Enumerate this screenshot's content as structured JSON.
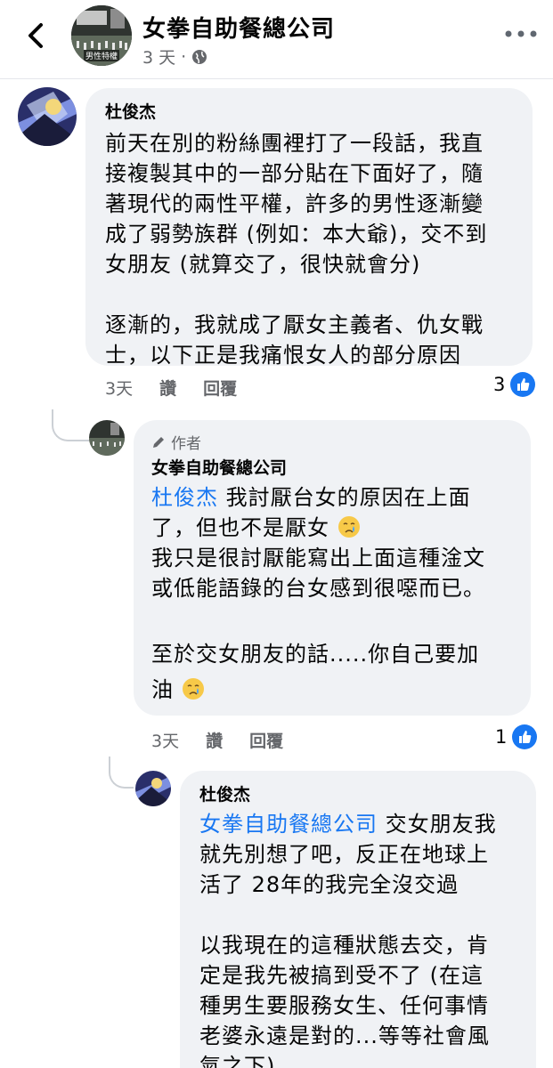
{
  "header": {
    "page_name": "女拳自助餐總公司",
    "time": "3 天",
    "dot": "·",
    "avatar_caption": "男性特權"
  },
  "comments": [
    {
      "author": "杜俊杰",
      "paragraphs": [
        "前天在別的粉絲團裡打了一段話，我直",
        "接複製其中的一部分貼在下面好了，隨",
        "著現代的兩性平權，許多的男性逐漸變",
        "成了弱勢族群 (例如：本大爺)，交不到",
        "女朋友 (就算交了，很快就會分)",
        "逐漸的，我就成了厭女主義者、仇女戰",
        "士，以下正是我痛恨女人的部分原因"
      ],
      "time": "3天",
      "like_label": "讚",
      "reply_label": "回覆",
      "like_count": "3"
    },
    {
      "badge": "作者",
      "author": "女拳自助餐總公司",
      "mention": "杜俊杰",
      "line1": " 我討厭台女的原因在上面",
      "line2": "了，但也不是厭女",
      "line3": "我只是很討厭能寫出上面這種淦文",
      "line4": "或低能語錄的台女感到很噁而已。",
      "line5": "至於交女朋友的話.....你自己要加",
      "line6": "油",
      "time": "3天",
      "like_label": "讚",
      "reply_label": "回覆",
      "like_count": "1"
    },
    {
      "author": "杜俊杰",
      "mention": "女拳自助餐總公司",
      "line1": " 交女朋友我",
      "line2": "就先別想了吧，反正在地球上",
      "line3": "活了 28年的我完全沒交過",
      "line4": "以我現在的這種狀態去交，肯",
      "line5": "定是我先被搞到受不了 (在這",
      "line6": "種男生要服務女生、任何事情",
      "line7": "老婆永遠是對的...等等社會風",
      "line8": "氣之下)"
    }
  ],
  "colors": {
    "accent": "#1877f2",
    "bubble": "#f0f2f5",
    "muted": "#65676b"
  }
}
